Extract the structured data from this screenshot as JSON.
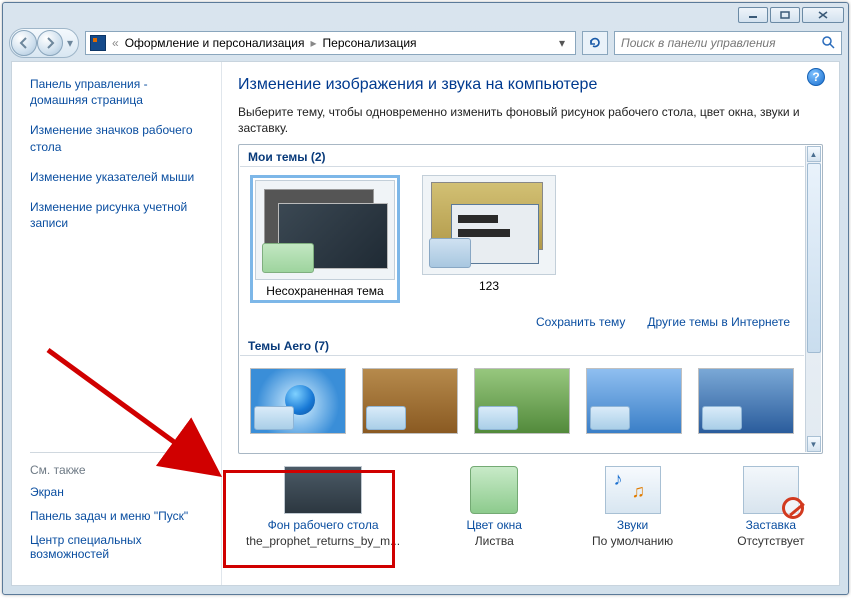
{
  "breadcrumb": {
    "level1": "Оформление и персонализация",
    "level2": "Персонализация"
  },
  "search": {
    "placeholder": "Поиск в панели управления"
  },
  "sidebar": {
    "home": "Панель управления - домашняя страница",
    "links": [
      "Изменение значков рабочего стола",
      "Изменение указателей мыши",
      "Изменение рисунка учетной записи"
    ],
    "seealso_hdr": "См. также",
    "seealso": [
      "Экран",
      "Панель задач и меню \"Пуск\"",
      "Центр специальных возможностей"
    ]
  },
  "main": {
    "title": "Изменение изображения и звука на компьютере",
    "desc": "Выберите тему, чтобы одновременно изменить фоновый рисунок рабочего стола, цвет окна, звуки и заставку.",
    "sections": {
      "my": "Мои темы (2)",
      "aero": "Темы Aero (7)"
    },
    "themes": {
      "unsaved": "Несохраненная тема",
      "t123": "123"
    },
    "actions": {
      "save": "Сохранить тему",
      "more": "Другие темы в Интернете"
    },
    "settings": {
      "bg": {
        "link": "Фон рабочего стола",
        "value": "the_prophet_returns_by_m..."
      },
      "color": {
        "link": "Цвет окна",
        "value": "Листва"
      },
      "sounds": {
        "link": "Звуки",
        "value": "По умолчанию"
      },
      "saver": {
        "link": "Заставка",
        "value": "Отсутствует"
      }
    }
  }
}
